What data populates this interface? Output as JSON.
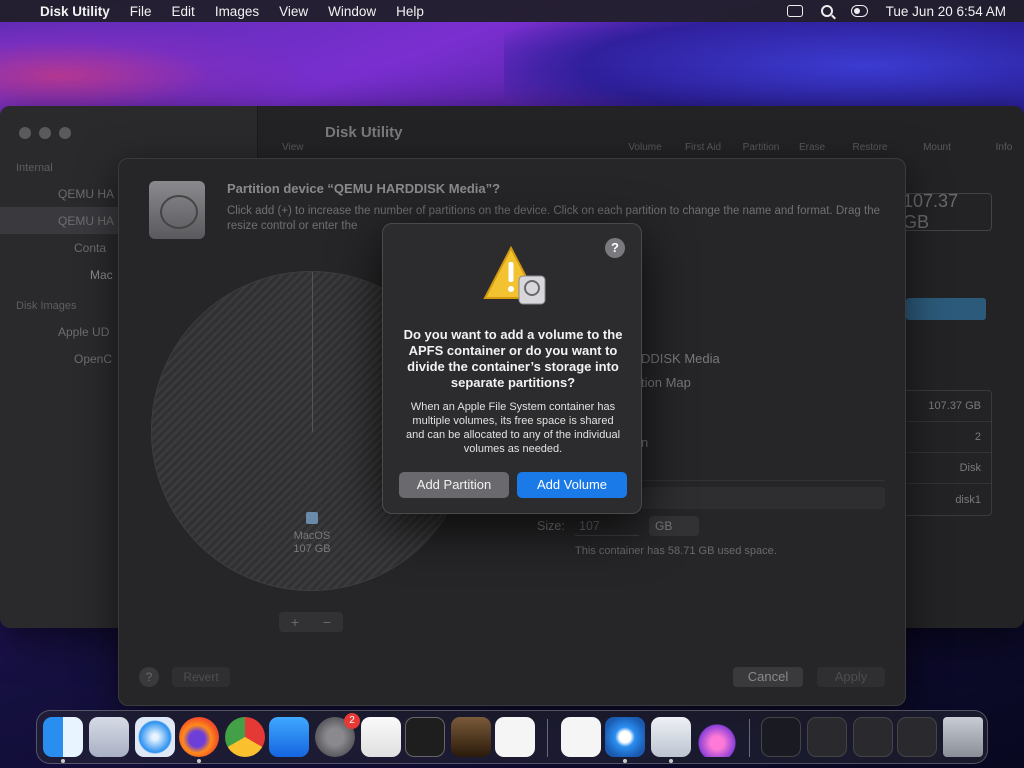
{
  "menubar": {
    "app_name": "Disk Utility",
    "menus": [
      "File",
      "Edit",
      "Images",
      "View",
      "Window",
      "Help"
    ],
    "datetime": "Tue Jun 20  6:54 AM"
  },
  "window": {
    "title": "Disk Utility",
    "view_label": "View",
    "toolbar": [
      "Volume",
      "First Aid",
      "Partition",
      "Erase",
      "Restore",
      "Mount",
      "Info"
    ],
    "sidebar": {
      "internal_header": "Internal",
      "items": [
        "QEMU HA",
        "QEMU HA",
        "Conta",
        "Mac"
      ],
      "disk_images_header": "Disk Images",
      "images": [
        "Apple UD",
        "OpenC"
      ]
    },
    "size_display": "107.37 GB",
    "info_values": [
      "107.37 GB",
      "2",
      "Disk",
      "disk1"
    ]
  },
  "sheet": {
    "title": "Partition device “QEMU HARDDISK Media”?",
    "description": "Click add (+) to increase the number of partitions on the device. Click on each partition to change the name and format. Drag the resize control or enter the",
    "pie_label_name": "MacOS",
    "pie_label_size": "107 GB",
    "plus": "+",
    "minus": "−",
    "right_text_1": "DDISK Media",
    "right_text_2": "tion Map",
    "right_text_3": "n",
    "size_label": "Size:",
    "size_value": "107",
    "size_unit": "GB",
    "container_note": "This container has 58.71 GB used space.",
    "help": "?",
    "revert": "Revert",
    "cancel": "Cancel",
    "apply": "Apply"
  },
  "alert": {
    "help": "?",
    "heading": "Do you want to add a volume to the APFS container or do you want to divide the container’s storage into separate partitions?",
    "body": "When an Apple File System container has multiple volumes, its free space is shared and can be allocated to any of the individual volumes as needed.",
    "add_partition": "Add Partition",
    "add_volume": "Add Volume"
  },
  "dock": {
    "settings_badge": "2"
  }
}
